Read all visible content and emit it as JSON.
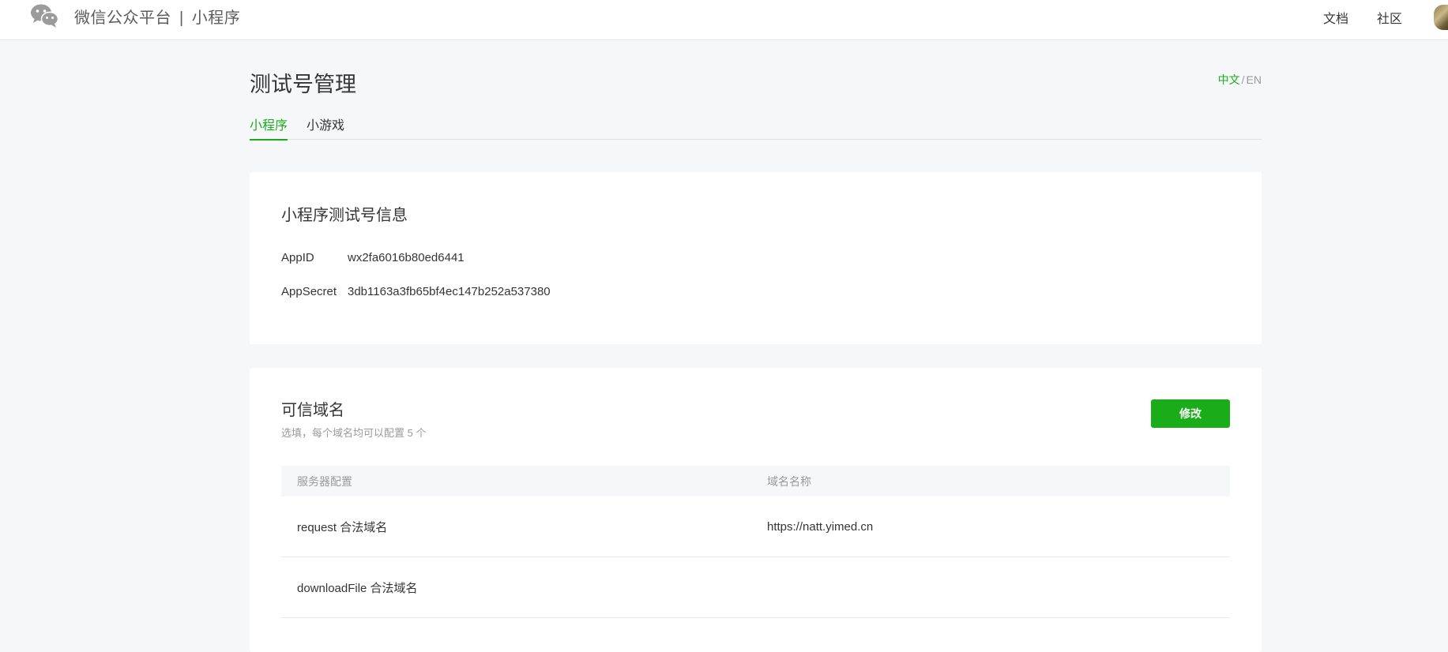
{
  "header": {
    "brand": "微信公众平台",
    "separator": "|",
    "product": "小程序",
    "links": [
      "文档",
      "社区"
    ]
  },
  "page": {
    "title": "测试号管理",
    "lang_zh": "中文",
    "lang_sep": "/",
    "lang_en": "EN",
    "tabs": [
      {
        "label": "小程序",
        "active": true
      },
      {
        "label": "小游戏",
        "active": false
      }
    ]
  },
  "info_card": {
    "title": "小程序测试号信息",
    "appid_label": "AppID",
    "appid_value": "wx2fa6016b80ed6441",
    "secret_label": "AppSecret",
    "secret_value": "3db1163a3fb65bf4ec147b252a537380"
  },
  "domain_card": {
    "title": "可信域名",
    "subtitle": "选填，每个域名均可以配置 5 个",
    "edit_label": "修改",
    "columns": [
      "服务器配置",
      "域名名称"
    ],
    "rows": [
      {
        "config": "request 合法域名",
        "domain": "https://natt.yimed.cn"
      },
      {
        "config": "downloadFile 合法域名",
        "domain": ""
      }
    ]
  },
  "colors": {
    "accent": "#1aad19",
    "background": "#f6f7f9",
    "text": "#353535",
    "muted": "#9a9a9a"
  },
  "icons": {
    "logo": "wechat-logo-icon",
    "avatar": "user-avatar"
  }
}
